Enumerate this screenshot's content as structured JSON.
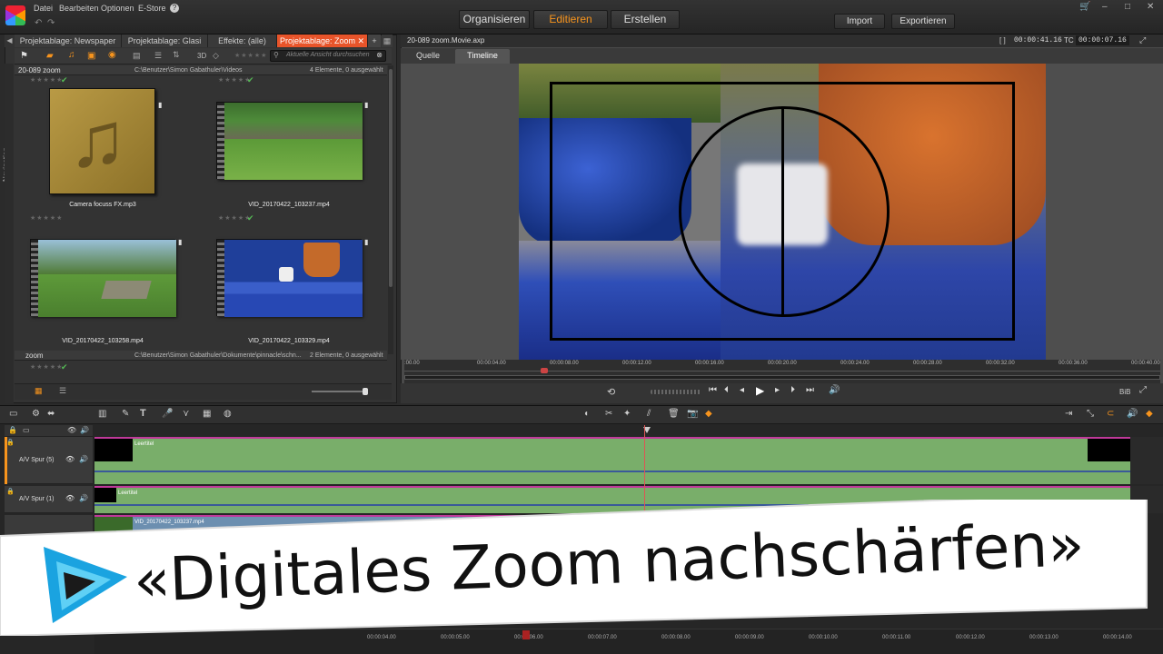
{
  "app": {
    "menu": [
      "Datei",
      "Bearbeiten",
      "Optionen",
      "E-Store"
    ],
    "help_label": "?",
    "mode_tabs": [
      "Organisieren",
      "Editieren",
      "Erstellen"
    ],
    "active_mode": "Editieren",
    "import_label": "Import",
    "export_label": "Exportieren",
    "accent_color": "#f7941d"
  },
  "library": {
    "tabs": [
      "Projektablage: Newspaper",
      "Projektablage: Glasi",
      "Effekte: (alle)",
      "Projektablage: Zoom"
    ],
    "active_tab": "Projektablage: Zoom",
    "view_3d_label": "3D",
    "search_placeholder": "Aktuelle Ansicht durchsuchen",
    "nav_label": "Navigation",
    "groups": [
      {
        "name": "20-089 zoom",
        "path": "C:\\Benutzer\\Simon Gabathuler\\Videos",
        "count": "4 Elemente, 0 ausgewählt"
      },
      {
        "name": "zoom",
        "path": "C:\\Benutzer\\Simon Gabathuler\\Dokumente\\pinnacle\\schn...",
        "count": "2 Elemente, 0 ausgewählt"
      }
    ],
    "items": [
      {
        "name": "Camera focuss FX.mp3",
        "type": "audio"
      },
      {
        "name": "VID_20170422_103237.mp4",
        "type": "video"
      },
      {
        "name": "VID_20170422_103258.mp4",
        "type": "video"
      },
      {
        "name": "VID_20170422_103329.mp4",
        "type": "video"
      }
    ]
  },
  "player": {
    "title": "20-089 zoom.Movie.axp",
    "duration": "00:00:41.16",
    "tc_label": "TC",
    "timecode": "00:00:07.16",
    "tabs": [
      "Quelle",
      "Timeline"
    ],
    "active_tab": "Timeline",
    "ruler_labels": [
      ":00.00",
      "00:00:04.00",
      "00:00:08.00",
      "00:00:12.00",
      "00:00:16.00",
      "00:00:20.00",
      "00:00:24.00",
      "00:00:28.00",
      "00:00:32.00",
      "00:00:36.00",
      "00:00:40.00"
    ],
    "playhead_fraction": 0.18,
    "bib_label": "BiB"
  },
  "timeline": {
    "tracks": [
      {
        "name": "A/V Spur (5)",
        "clip": "Leertitel"
      },
      {
        "name": "A/V Spur (1)",
        "clip": "Leertitel"
      },
      {
        "name": "",
        "clip": "VID_20170422_103237.mp4"
      }
    ],
    "ruler_labels": [
      "00:00:04.00",
      "00:00:05.00",
      "00:00:06.00",
      "00:00:07.00",
      "00:00:08.00",
      "00:00:09.00",
      "00:00:10.00",
      "00:00:11.00",
      "00:00:12.00",
      "00:00:13.00",
      "00:00:14.00"
    ]
  },
  "banner": {
    "title": "«Digitales Zoom nachschärfen»",
    "logo_icon": "play-logo-icon"
  }
}
